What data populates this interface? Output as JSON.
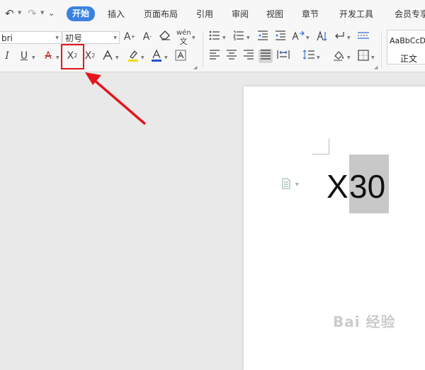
{
  "quick_access": {
    "undo_icon": "undo-icon",
    "redo_icon": "redo-icon",
    "customize_icon": "customize-quick-access-icon"
  },
  "menu": {
    "tabs": [
      {
        "label": "开始",
        "active": true
      },
      {
        "label": "插入"
      },
      {
        "label": "页面布局"
      },
      {
        "label": "引用"
      },
      {
        "label": "审阅"
      },
      {
        "label": "视图"
      },
      {
        "label": "章节"
      },
      {
        "label": "开发工具"
      },
      {
        "label": "会员专享"
      }
    ],
    "active_color": "#3b82e0"
  },
  "ribbon": {
    "font_name": "bri",
    "font_size": "初号",
    "buttons": {
      "grow_font": "grow-font-icon",
      "shrink_font": "shrink-font-icon",
      "clear_format": "clear-format-icon",
      "pinyin": "pinyin-guide-icon",
      "italic": "italic-icon",
      "underline": "underline-icon",
      "strikethrough": "strikethrough-icon",
      "superscript": "superscript-icon",
      "subscript": "subscript-icon",
      "text_effect": "text-effect-icon",
      "highlight": "highlight-color-icon",
      "font_color": "font-color-icon",
      "char_border": "character-border-icon"
    },
    "style_gallery": {
      "sample": "AaBbCcD",
      "name": "正文"
    }
  },
  "document": {
    "text_base": "X",
    "text_selected": "30"
  },
  "annotation": {
    "color": "#e5161c"
  },
  "watermark": "Bai 经验"
}
